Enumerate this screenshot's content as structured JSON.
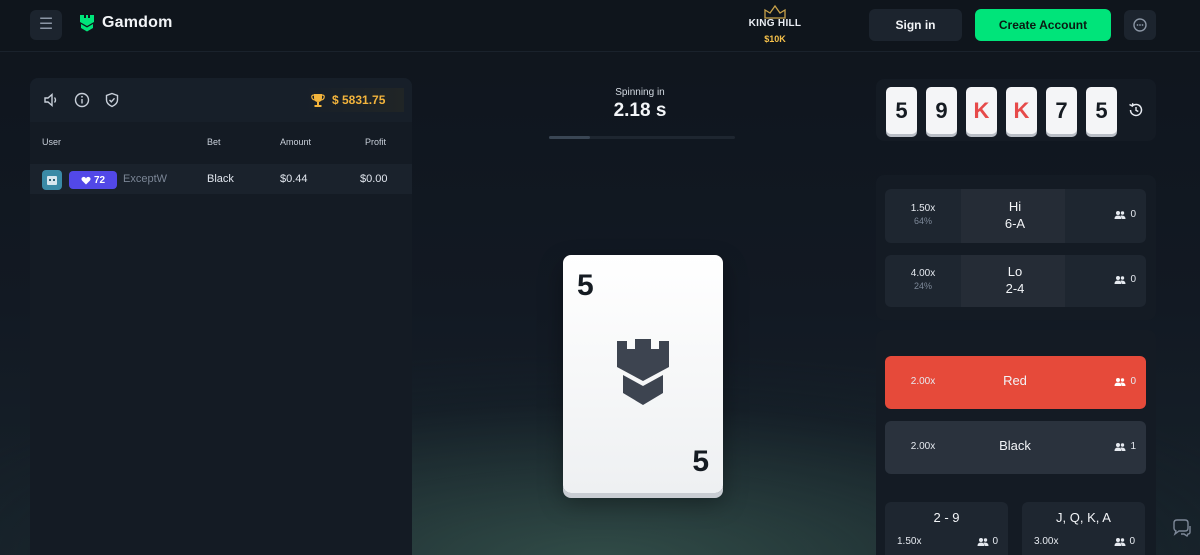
{
  "header": {
    "menu_icon": "hamburger-icon",
    "logo_text": "Gamdom",
    "promo_title": "KING HILL",
    "promo_amount": "$10K",
    "signin_label": "Sign in",
    "create_label": "Create Account",
    "chat_icon": "chat-bubble-icon",
    "accent_color": "#00e47a"
  },
  "left_panel": {
    "icons": [
      "speaker-icon",
      "info-icon",
      "shield-icon"
    ],
    "pot_value": "$ 5831.75",
    "columns": {
      "user": "User",
      "bet": "Bet",
      "amount": "Amount",
      "profit": "Profit"
    },
    "rows": [
      {
        "level": "72",
        "username": "ExceptW",
        "bet": "Black",
        "amount": "$0.44",
        "profit": "$0.00"
      }
    ]
  },
  "center": {
    "spin_label": "Spinning in",
    "spin_value": "2.18 s",
    "spin_progress": 0.22,
    "card_rank": "5"
  },
  "history": {
    "cards": [
      {
        "rank": "5",
        "color": "#151b22"
      },
      {
        "rank": "9",
        "color": "#151b22"
      },
      {
        "rank": "K",
        "color": "#e64a4a"
      },
      {
        "rank": "K",
        "color": "#e64a4a"
      },
      {
        "rank": "7",
        "color": "#151b22"
      },
      {
        "rank": "5",
        "color": "#151b22"
      }
    ]
  },
  "bets": {
    "hi": {
      "mult": "1.50x",
      "prob": "64%",
      "label": "Hi",
      "range": "6-A",
      "count": "0"
    },
    "lo": {
      "mult": "4.00x",
      "prob": "24%",
      "label": "Lo",
      "range": "2-4",
      "count": "0"
    },
    "red": {
      "mult": "2.00x",
      "label": "Red",
      "count": "0",
      "color": "#e64a3a"
    },
    "black": {
      "mult": "2.00x",
      "label": "Black",
      "count": "1"
    },
    "num": {
      "label": "2 - 9",
      "mult": "1.50x",
      "count": "0"
    },
    "face": {
      "label": "J, Q, K, A",
      "mult": "3.00x",
      "count": "0"
    }
  }
}
